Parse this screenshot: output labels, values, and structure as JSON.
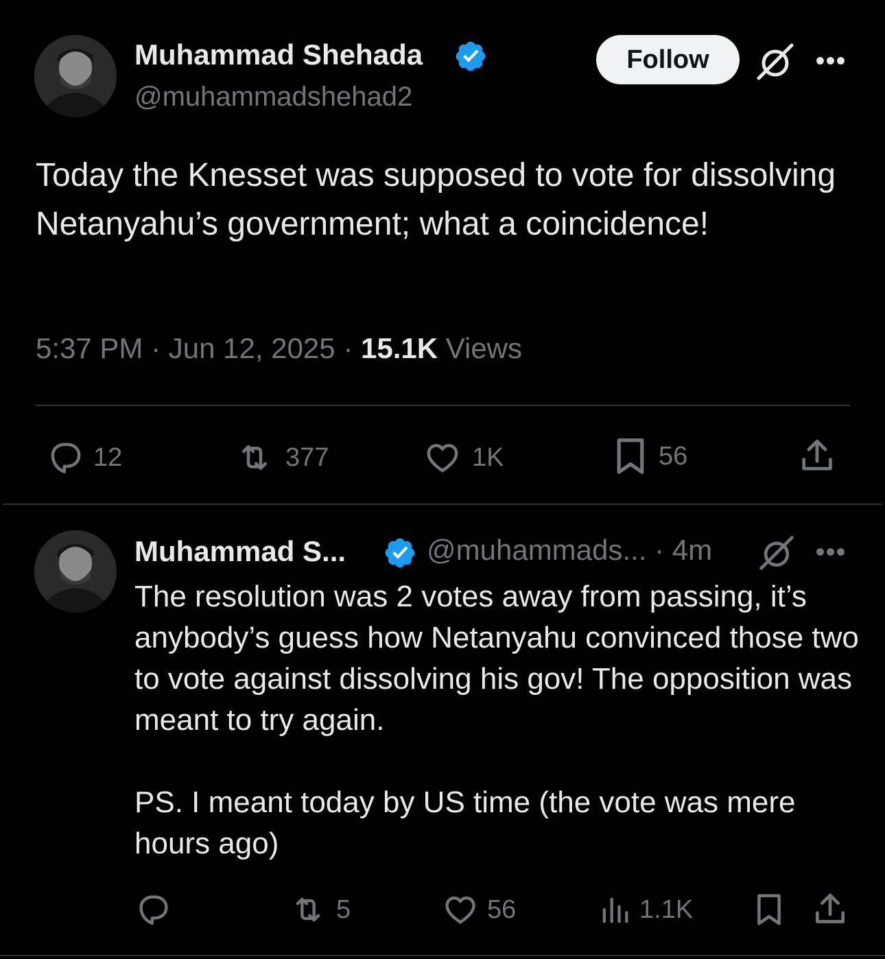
{
  "tweet": {
    "author_name": "Muhammad Shehada",
    "author_handle": "@muhammadshehad2",
    "follow_label": "Follow",
    "more_label": "•••",
    "text": "Today the Knesset was supposed to vote for dissolving Netanyahu’s government; what a coincidence!",
    "time": "5:37 PM",
    "sep1": "·",
    "date": "Jun 12, 2025",
    "sep2": "·",
    "views_count": "15.1K",
    "views_label": "Views",
    "actions": {
      "replies": "12",
      "reposts": "377",
      "likes": "1K",
      "bookmarks": "56"
    }
  },
  "reply": {
    "author_name": "Muhammad S...",
    "author_handle": "@muhammads...",
    "time_sep": "·",
    "time": "4m",
    "more_label": "•••",
    "text": "The resolution was 2 votes away from passing, it’s anybody’s guess how Netanyahu convinced those two to vote against dissolving his gov! The opposition was meant to try again.\n\nPS. I meant today by US time (the vote was mere hours ago)",
    "actions": {
      "reposts": "5",
      "likes": "56",
      "views": "1.1K"
    }
  },
  "colors": {
    "background": "#000000",
    "text": "#e7e9ea",
    "muted": "#71767b",
    "verified": "#1d9bf0",
    "divider": "#2f3336"
  }
}
